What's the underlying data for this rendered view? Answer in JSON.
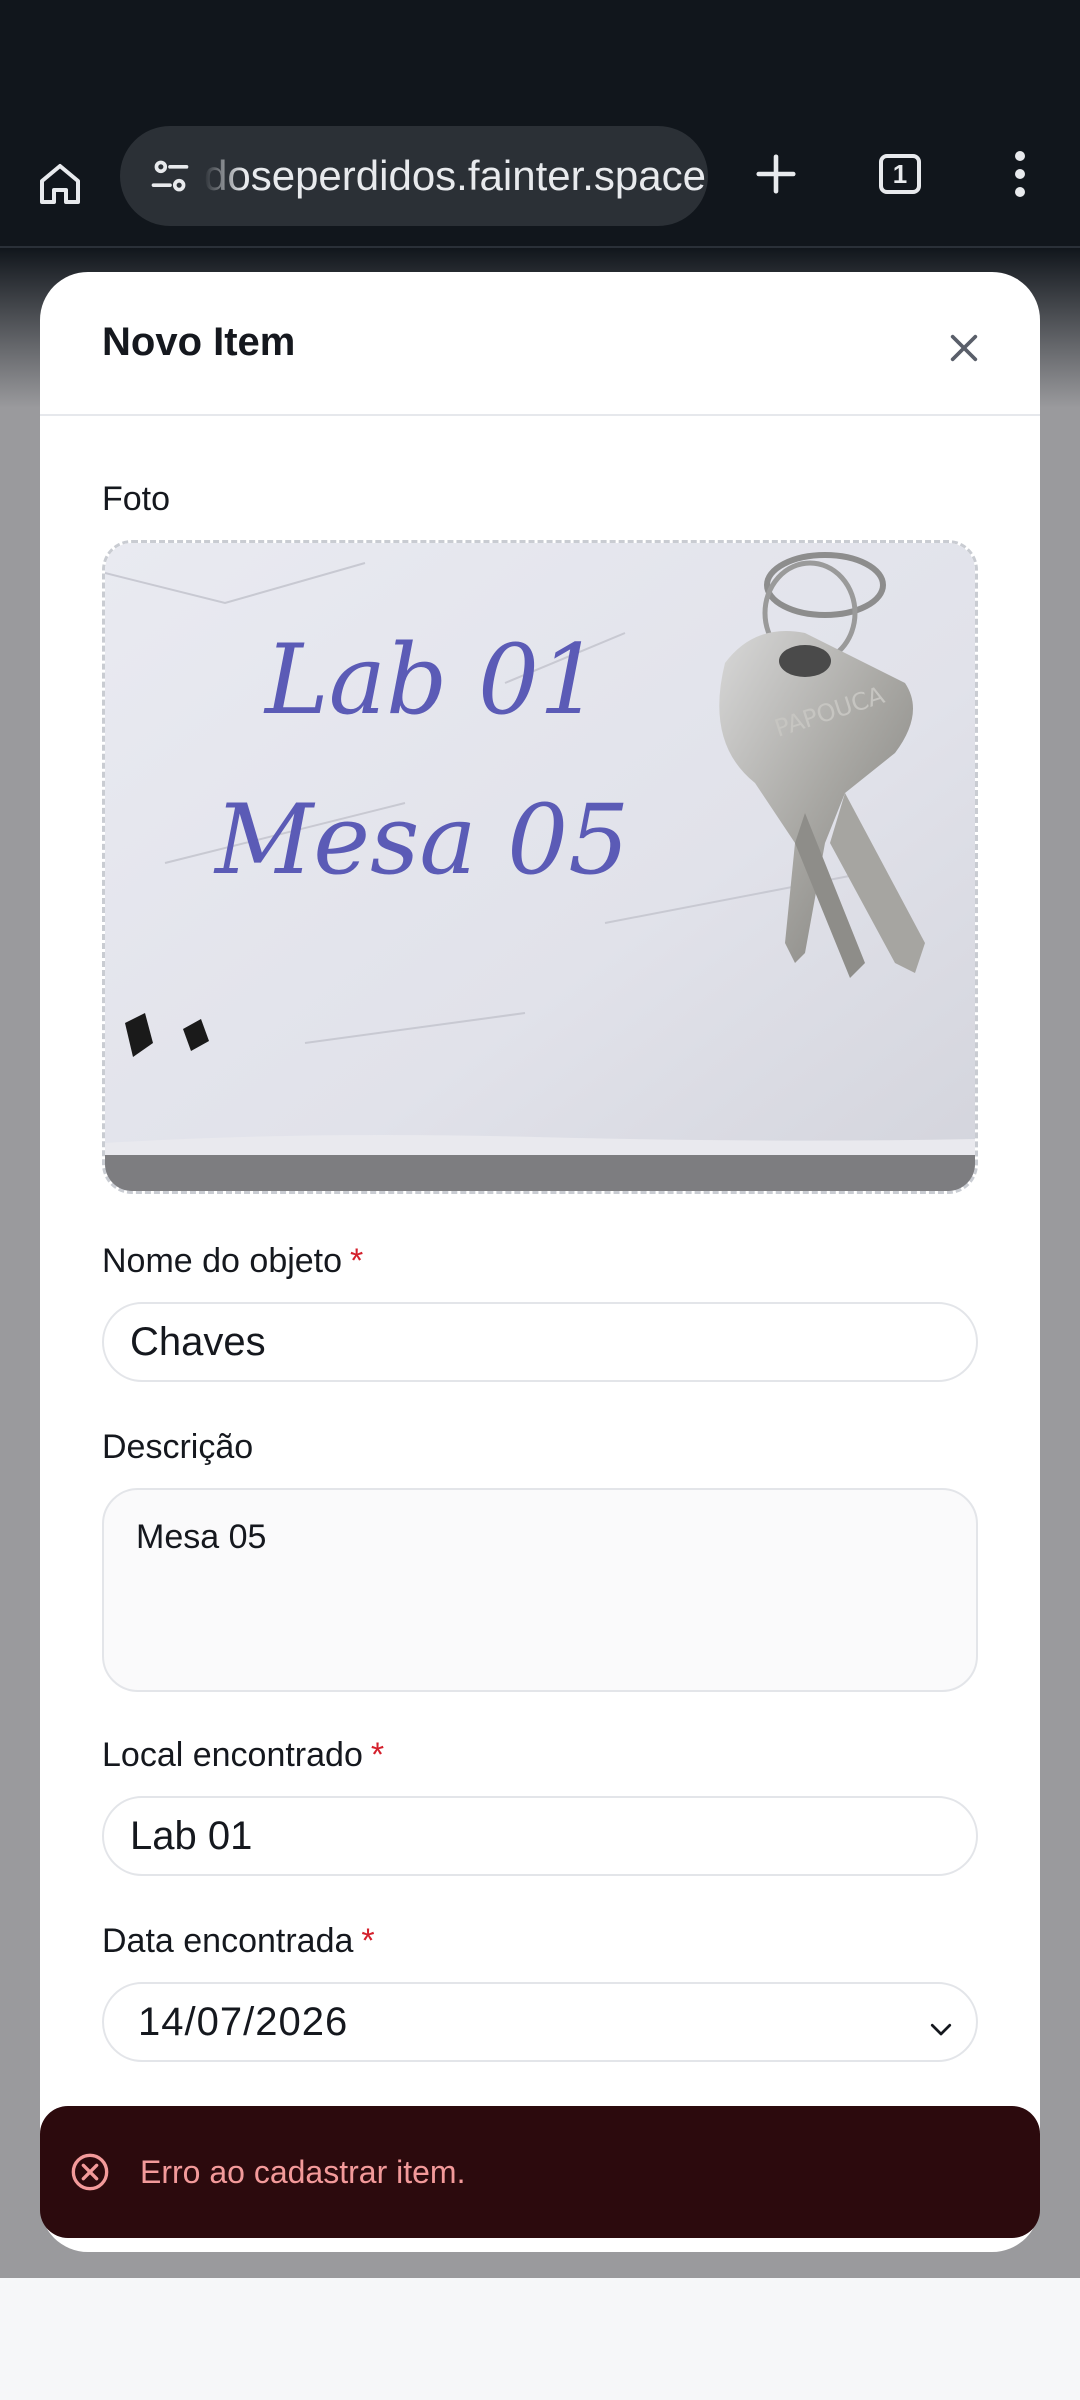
{
  "browser": {
    "url_text": "doseperdidos.fainter.space",
    "tab_count": "1"
  },
  "modal": {
    "title": "Novo Item",
    "photo_label": "Foto",
    "photo_handwriting_line1": "Lab 01",
    "photo_handwriting_line2": "Mesa 05",
    "photo_key_brand": "PAPOUCA",
    "name_label": "Nome do objeto",
    "name_value": "Chaves",
    "description_label": "Descrição",
    "description_value": "Mesa 05",
    "location_label": "Local encontrado",
    "location_value": "Lab 01",
    "date_label": "Data encontrada",
    "date_value": "14/07/2026",
    "required_mark": "*"
  },
  "toast": {
    "message": "Erro ao cadastrar item."
  },
  "colors": {
    "required": "#d4202c",
    "toast_bg": "#2c0a0d",
    "toast_text": "#f39a9a"
  }
}
